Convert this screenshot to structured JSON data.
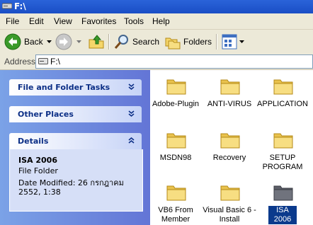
{
  "window": {
    "title": "F:\\"
  },
  "menu": [
    "File",
    "Edit",
    "View",
    "Favorites",
    "Tools",
    "Help"
  ],
  "toolbar": {
    "back_label": "Back",
    "search_label": "Search",
    "folders_label": "Folders"
  },
  "address": {
    "label": "Address",
    "value": "F:\\"
  },
  "sidebar": {
    "file_folder_tasks": "File and Folder Tasks",
    "other_places": "Other Places",
    "details": {
      "title": "Details",
      "name": "ISA 2006",
      "type": "File Folder",
      "modified": "Date Modified: 26 กรกฎาคม 2552, 1:38"
    }
  },
  "folders": [
    {
      "name": "Adobe-Plugin",
      "selected": false
    },
    {
      "name": "ANTI-VIRUS",
      "selected": false
    },
    {
      "name": "APPLICATION",
      "selected": false
    },
    {
      "name": "MSDN98",
      "selected": false
    },
    {
      "name": "Recovery",
      "selected": false
    },
    {
      "name": "SETUP PROGRAM",
      "selected": false
    },
    {
      "name": "VB6 From Member",
      "selected": false
    },
    {
      "name": "Visual Basic 6 - Install",
      "selected": false
    },
    {
      "name": "ISA 2006",
      "selected": true
    }
  ],
  "colors": {
    "title_bar": "#1a4ec5",
    "task_pane": "#6375d6",
    "selection": "#0b3a8c",
    "folder": "#f5d66a"
  }
}
